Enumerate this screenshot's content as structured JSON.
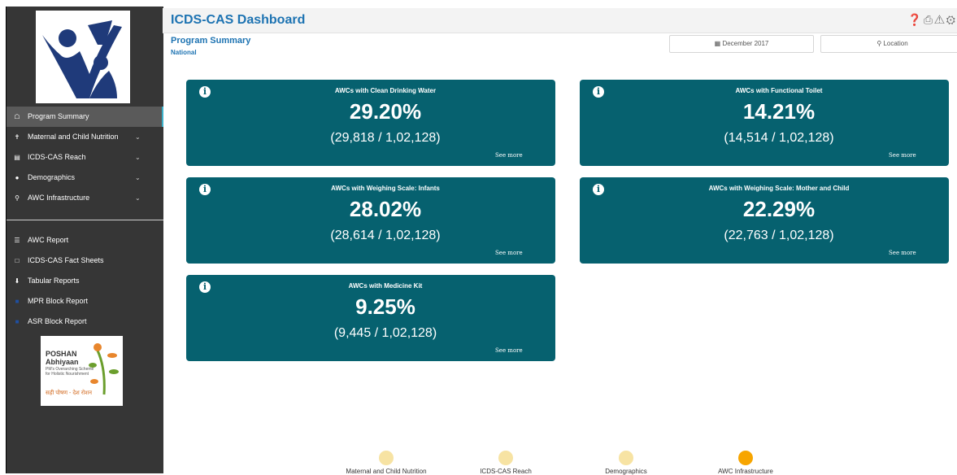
{
  "app": {
    "title": "ICDS-CAS Dashboard"
  },
  "header_icons": [
    "help-icon",
    "print-icon",
    "warning-icon",
    "gear-icon"
  ],
  "page": {
    "title": "Program Summary",
    "subtitle": "National"
  },
  "filters": {
    "date": "December 2017",
    "location": "Location"
  },
  "sidebar": {
    "items": [
      {
        "label": "Program Summary",
        "icon": "home-icon",
        "active": true
      },
      {
        "label": "Maternal and Child Nutrition",
        "icon": "person-icon",
        "expandable": true
      },
      {
        "label": "ICDS-CAS Reach",
        "icon": "chart-icon",
        "expandable": true
      },
      {
        "label": "Demographics",
        "icon": "people-icon",
        "expandable": true
      },
      {
        "label": "AWC Infrastructure",
        "icon": "pin-icon",
        "expandable": true
      }
    ],
    "reports": [
      {
        "label": "AWC Report",
        "icon": "list-icon"
      },
      {
        "label": "ICDS-CAS Fact Sheets",
        "icon": "document-icon"
      },
      {
        "label": "Tabular Reports",
        "icon": "download-icon"
      },
      {
        "label": "MPR Block Report",
        "icon": "report-icon"
      },
      {
        "label": "ASR Block Report",
        "icon": "report-icon"
      }
    ],
    "poshan": {
      "line1": "POSHAN",
      "line2": "Abhiyaan",
      "tagline": "PM's Overarching Scheme for Holistic Nourishment",
      "hindi": "सही पोषण - देश रोशन"
    }
  },
  "cards": [
    {
      "title": "AWCs with Clean Drinking Water",
      "percent": "29.20%",
      "fraction": "(29,818 / 1,02,128)",
      "more": "See more"
    },
    {
      "title": "AWCs with Functional Toilet",
      "percent": "14.21%",
      "fraction": "(14,514 / 1,02,128)",
      "more": "See more"
    },
    {
      "title": "AWCs with Weighing Scale: Infants",
      "percent": "28.02%",
      "fraction": "(28,614 / 1,02,128)",
      "more": "See more"
    },
    {
      "title": "AWCs with Weighing Scale: Mother and Child",
      "percent": "22.29%",
      "fraction": "(22,763 / 1,02,128)",
      "more": "See more"
    },
    {
      "title": "AWCs with Medicine Kit",
      "percent": "9.25%",
      "fraction": "(9,445 / 1,02,128)",
      "more": "See more"
    }
  ],
  "steps": [
    {
      "label": "Maternal and Child Nutrition",
      "color": "#f7e3a3",
      "active": false
    },
    {
      "label": "ICDS-CAS Reach",
      "color": "#f7e3a3",
      "active": false
    },
    {
      "label": "Demographics",
      "color": "#f7e3a3",
      "active": false
    },
    {
      "label": "AWC Infrastructure",
      "color": "#f7a500",
      "active": true
    }
  ],
  "colors": {
    "card": "#06616f",
    "sidebar": "#363636",
    "accent": "#1d73b2"
  }
}
